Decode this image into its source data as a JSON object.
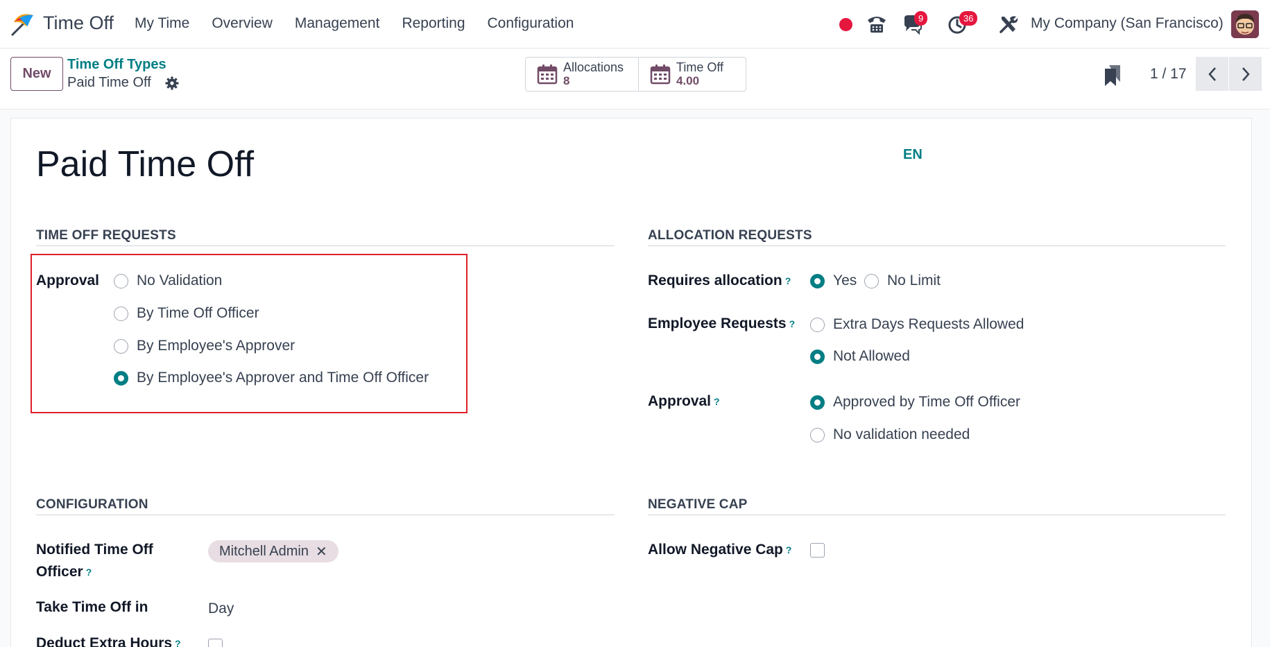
{
  "navbar": {
    "app_name": "Time Off",
    "menu": [
      "My Time",
      "Overview",
      "Management",
      "Reporting",
      "Configuration"
    ],
    "messages_badge": "9",
    "activities_badge": "36",
    "company": "My Company (San Francisco)"
  },
  "control": {
    "new_label": "New",
    "breadcrumb_parent": "Time Off Types",
    "breadcrumb_current": "Paid Time Off",
    "smart_buttons": [
      {
        "label": "Allocations",
        "value": "8"
      },
      {
        "label": "Time Off",
        "value": "4.00"
      }
    ],
    "pager": "1 / 17"
  },
  "form": {
    "title": "Paid Time Off",
    "lang": "EN",
    "time_off_requests": {
      "section_title": "TIME OFF REQUESTS",
      "approval_label": "Approval",
      "options": [
        {
          "label": "No Validation",
          "selected": false
        },
        {
          "label": "By Time Off Officer",
          "selected": false
        },
        {
          "label": "By Employee's Approver",
          "selected": false
        },
        {
          "label": "By Employee's Approver and Time Off Officer",
          "selected": true
        }
      ]
    },
    "allocation_requests": {
      "section_title": "ALLOCATION REQUESTS",
      "requires_allocation_label": "Requires allocation",
      "requires_allocation_options": [
        {
          "label": "Yes",
          "selected": true
        },
        {
          "label": "No Limit",
          "selected": false
        }
      ],
      "employee_requests_label": "Employee Requests",
      "employee_requests_options": [
        {
          "label": "Extra Days Requests Allowed",
          "selected": false
        },
        {
          "label": "Not Allowed",
          "selected": true
        }
      ],
      "approval_label": "Approval",
      "approval_options": [
        {
          "label": "Approved by Time Off Officer",
          "selected": true
        },
        {
          "label": "No validation needed",
          "selected": false
        }
      ]
    },
    "configuration": {
      "section_title": "CONFIGURATION",
      "notified_officer_label_1": "Notified Time Off",
      "notified_officer_label_2": "Officer",
      "notified_officer_tag": "Mitchell Admin",
      "take_time_off_label": "Take Time Off in",
      "take_time_off_value": "Day",
      "deduct_extra_hours_label": "Deduct Extra Hours"
    },
    "negative_cap": {
      "section_title": "NEGATIVE CAP",
      "allow_negative_cap_label": "Allow Negative Cap"
    },
    "help_mark": "?"
  },
  "colors": {
    "primary": "#714b67",
    "accent": "#017e84",
    "badge": "#e5173f",
    "highlight_box": "#e01f2b"
  }
}
